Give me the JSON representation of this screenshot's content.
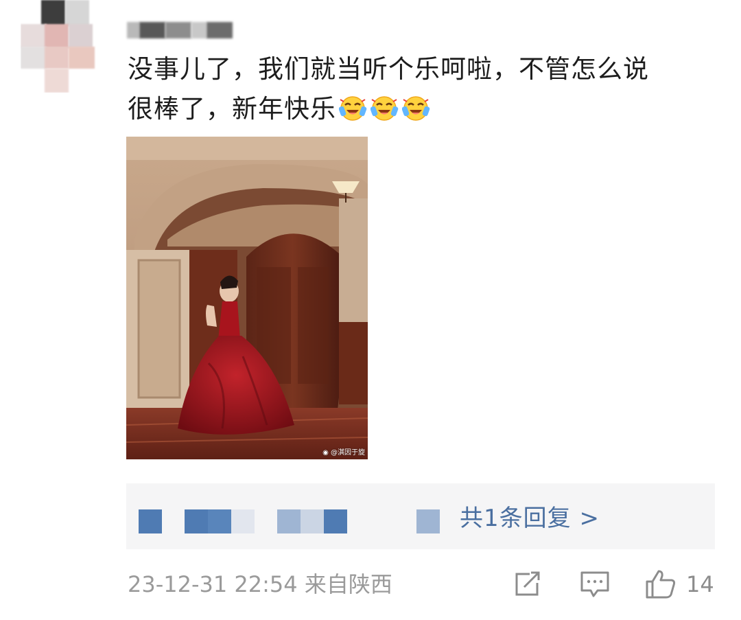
{
  "comment": {
    "line1": "没事儿了，我们就当听个乐呵啦，不管怎么说",
    "line2": "很棒了，新年快乐",
    "emoji_count": 3,
    "emoji_icon": "laughing-crying-face-icon"
  },
  "photo": {
    "watermark": "@淇因于旋",
    "weibo_icon": "weibo-logo-icon"
  },
  "replies": {
    "summary": "共1条回复 >"
  },
  "footer": {
    "timestamp": "23-12-31 22:54",
    "location": "来自陕西",
    "share_icon": "share-icon",
    "comment_icon": "comment-icon",
    "like_icon": "thumbs-up-icon",
    "like_count": "14"
  },
  "colors": {
    "link": "#4a6fa0",
    "meta": "#9a9a9a",
    "reply_bg": "#f5f5f6"
  }
}
